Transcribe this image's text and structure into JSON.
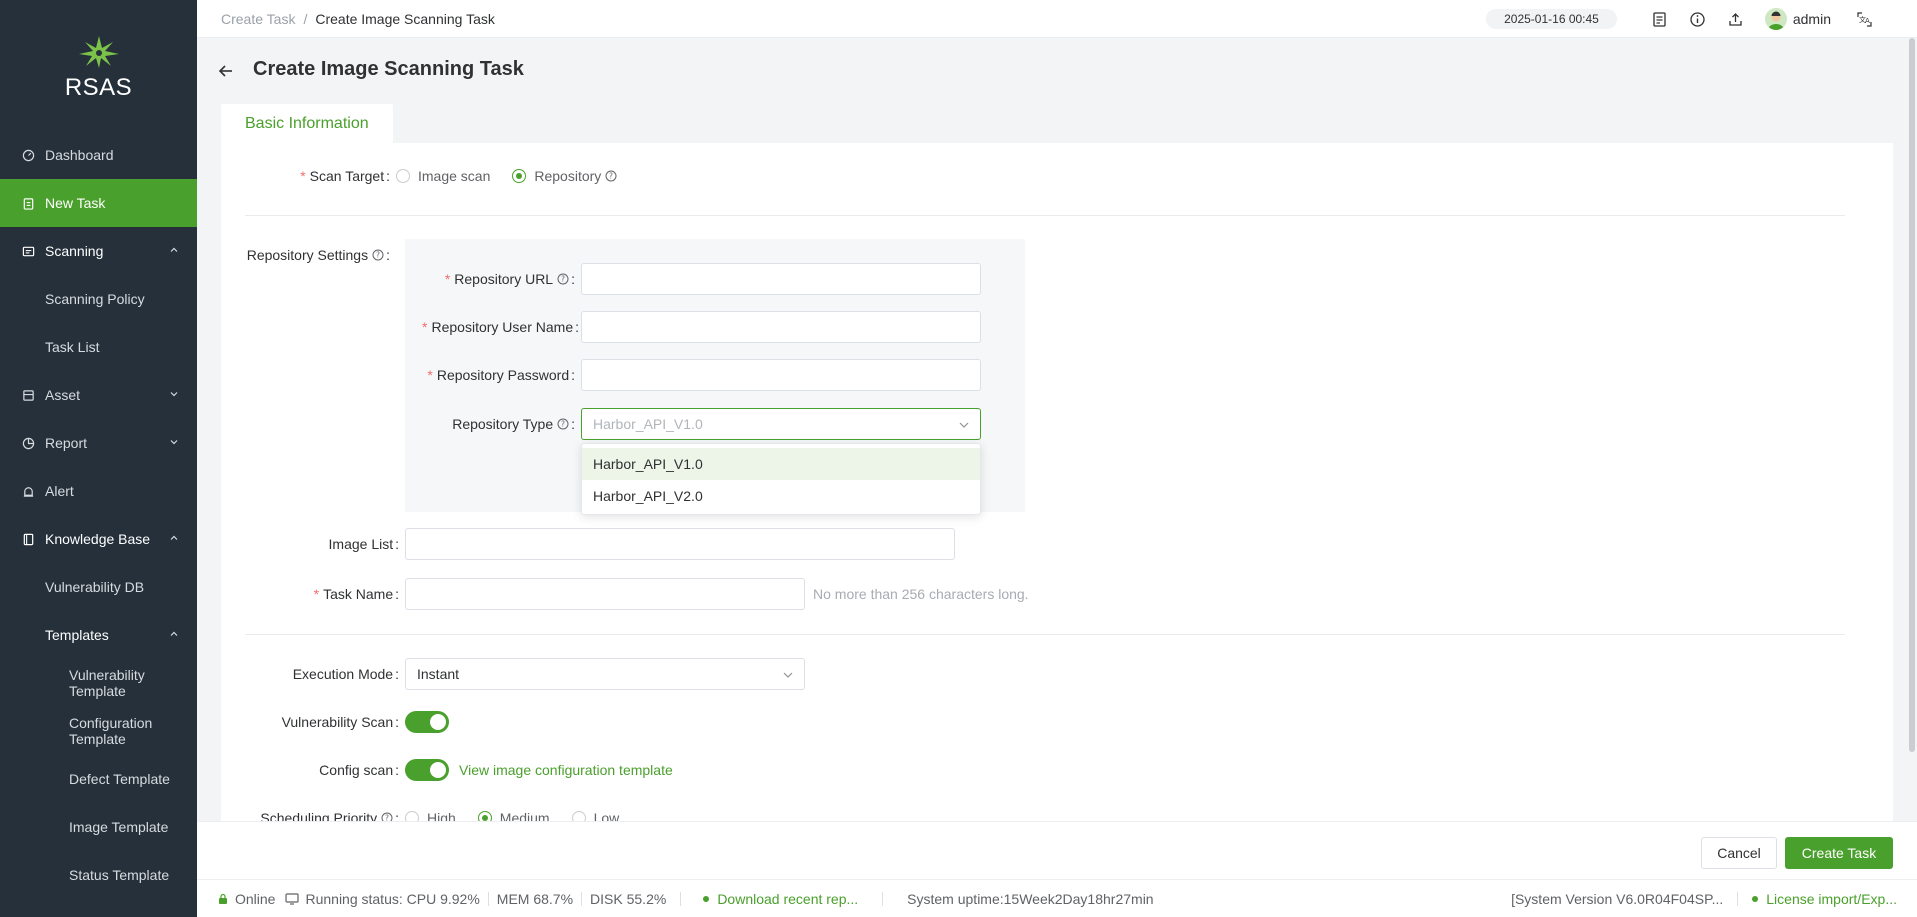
{
  "app": {
    "name": "RSAS"
  },
  "sidebar": {
    "items": [
      {
        "label": "Dashboard"
      },
      {
        "label": "New Task"
      },
      {
        "label": "Scanning"
      },
      {
        "label": "Scanning Policy"
      },
      {
        "label": "Task List"
      },
      {
        "label": "Asset"
      },
      {
        "label": "Report"
      },
      {
        "label": "Alert"
      },
      {
        "label": "Knowledge Base"
      },
      {
        "label": "Vulnerability DB"
      },
      {
        "label": "Templates"
      },
      {
        "label": "Vulnerability Template"
      },
      {
        "label": "Configuration Template"
      },
      {
        "label": "Defect Template"
      },
      {
        "label": "Image Template"
      },
      {
        "label": "Status Template"
      }
    ]
  },
  "header": {
    "breadcrumb": [
      "Create Task",
      "Create Image Scanning Task"
    ],
    "breadcrumb_sep": "/",
    "datetime": "2025-01-16 00:45",
    "user": "admin"
  },
  "page": {
    "title": "Create Image Scanning Task",
    "tab": "Basic Information"
  },
  "form": {
    "scan_target": {
      "label": "Scan Target",
      "options": [
        "Image scan",
        "Repository"
      ],
      "selected": "Repository"
    },
    "repo_settings": {
      "label": "Repository Settings"
    },
    "repo_url": {
      "label": "Repository URL",
      "value": ""
    },
    "repo_user": {
      "label": "Repository User Name",
      "value": ""
    },
    "repo_password": {
      "label": "Repository Password",
      "value": ""
    },
    "repo_type": {
      "label": "Repository Type",
      "placeholder": "Harbor_API_V1.0",
      "options": [
        "Harbor_API_V1.0",
        "Harbor_API_V2.0"
      ]
    },
    "image_list": {
      "label": "Image List",
      "value": ""
    },
    "task_name": {
      "label": "Task Name",
      "value": "",
      "hint": "No more than 256 characters long."
    },
    "execution_mode": {
      "label": "Execution Mode",
      "value": "Instant"
    },
    "vuln_scan": {
      "label": "Vulnerability Scan",
      "on": true
    },
    "config_scan": {
      "label": "Config scan",
      "on": true,
      "link": "View image configuration template"
    },
    "priority": {
      "label": "Scheduling Priority",
      "options": [
        "High",
        "Medium",
        "Low"
      ],
      "selected": "Medium"
    }
  },
  "actions": {
    "cancel": "Cancel",
    "create": "Create Task"
  },
  "status": {
    "online": "Online",
    "running": "Running status: CPU 9.92%",
    "mem": "MEM 68.7%",
    "disk": "DISK 55.2%",
    "download": "Download recent rep...",
    "uptime": "System uptime:15Week2Day18hr27min",
    "version": "[System Version V6.0R04F04SP...",
    "license": "License import/Exp..."
  },
  "colors": {
    "accent": "#4aa02c",
    "sidebar": "#25303a",
    "required": "#f56c6c"
  }
}
